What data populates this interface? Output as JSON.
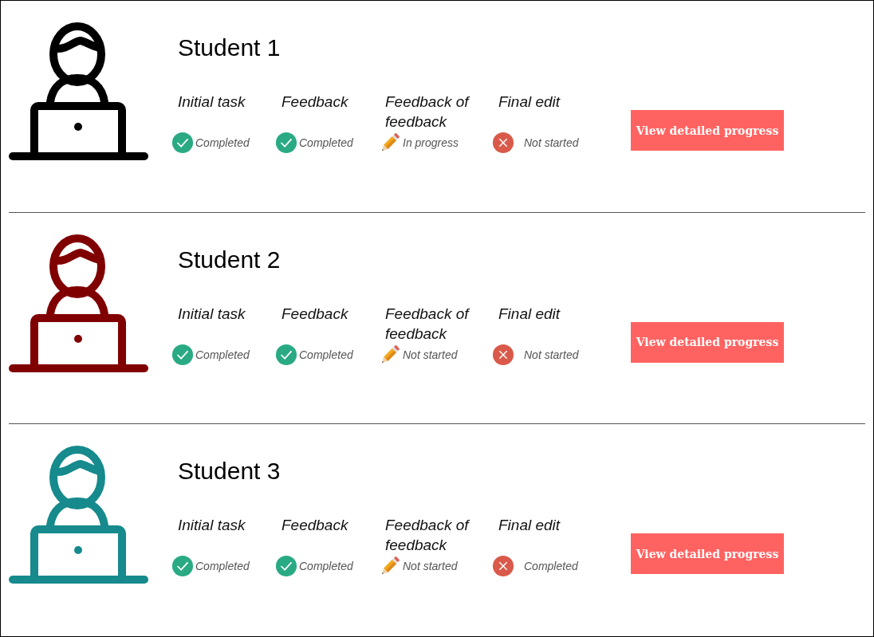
{
  "students": [
    {
      "name": "Student 1",
      "color": "#000000",
      "button": "View detailed progress",
      "tasks": [
        {
          "label": "Initial task",
          "kind": "check",
          "status": "Completed"
        },
        {
          "label": "Feedback",
          "kind": "check",
          "status": "Completed"
        },
        {
          "label": "Feedback of feedback",
          "kind": "pencil",
          "status": "In progress"
        },
        {
          "label": "Final edit",
          "kind": "cross",
          "status": "Not started"
        }
      ]
    },
    {
      "name": "Student 2",
      "color": "#800000",
      "button": "View detailed progress",
      "tasks": [
        {
          "label": "Initial task",
          "kind": "check",
          "status": "Completed"
        },
        {
          "label": "Feedback",
          "kind": "check",
          "status": "Completed"
        },
        {
          "label": "Feedback of feedback",
          "kind": "pencil",
          "status": "Not started"
        },
        {
          "label": "Final edit",
          "kind": "cross",
          "status": "Not started"
        }
      ]
    },
    {
      "name": "Student 3",
      "color": "#168a8c",
      "button": "View detailed progress",
      "tasks": [
        {
          "label": "Initial task",
          "kind": "check",
          "status": "Completed"
        },
        {
          "label": "Feedback",
          "kind": "check",
          "status": "Completed"
        },
        {
          "label": "Feedback of feedback",
          "kind": "pencil",
          "status": "Not started"
        },
        {
          "label": "Final edit",
          "kind": "cross",
          "status": "Completed"
        }
      ]
    }
  ]
}
